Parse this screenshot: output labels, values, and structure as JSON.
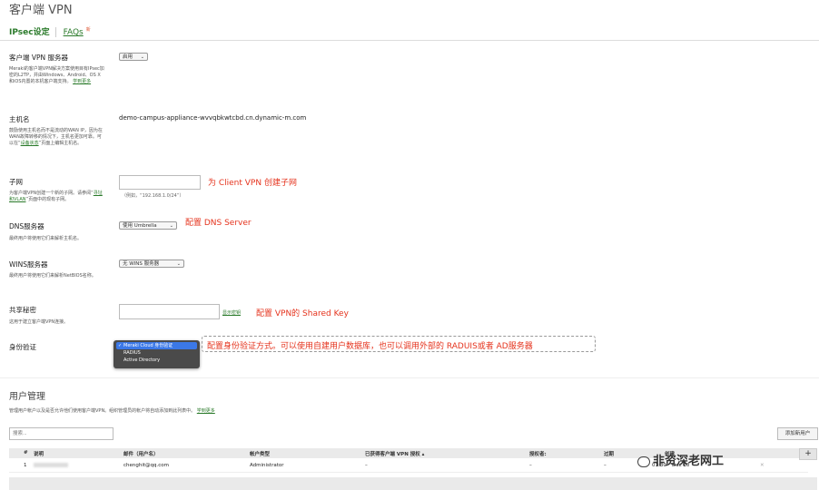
{
  "header": {
    "title": "客户端 VPN",
    "tab_ipsec": "IPsec设定",
    "tab_faqs": "FAQs",
    "tab_faqs_badge": "新"
  },
  "vpn_server": {
    "label": "客户端 VPN 服务器",
    "value": "启用",
    "desc": "Meraki的客户端VPN解决方案使用目有IPsec加密的L2TP，并由Windows、Android、OS X和iOS内置的本机客户端支持。",
    "learn_more": "学到更多"
  },
  "hostname": {
    "label": "主机名",
    "value": "demo-campus-appliance-wvvqbkwtcbd.cn.dynamic-m.com",
    "desc": "鼓励使用主机名而不是流动的WAN IP，因为在WAN故障转移的情况下，主机名更加可靠。可以在“",
    "link": "设备状态",
    "desc_end": "”页面上编辑主机名。"
  },
  "subnet": {
    "label": "子网",
    "value": "",
    "hint": "（例如，“192.168.1.0/24”）",
    "desc": "为客户端VPN创建一个新的子网。请参阅“",
    "link": "寻址和VLAN",
    "desc_end": "”页面中的现有子网。",
    "annotation": "为 Client VPN 创建子网"
  },
  "dns": {
    "label": "DNS服务器",
    "value": "使用 Umbrella",
    "desc": "最终用户将使用它们来解析主机名。",
    "annotation": "配置 DNS Server"
  },
  "wins": {
    "label": "WINS服务器",
    "value": "无 WINS 服务器",
    "desc": "最终用户将使用它们来解析NetBIOS名称。"
  },
  "secret": {
    "label": "共享秘密",
    "value": "",
    "show_link": "显示密钥",
    "desc": "这用于建立客户端VPN连接。",
    "annotation": "配置 VPN的 Shared Key"
  },
  "auth": {
    "label": "身份验证",
    "options": [
      "Meraki Cloud 身份验证",
      "RADIUS",
      "Active Directory"
    ],
    "selected_check": "✓",
    "annotation": "配置身份验证方式。可以使用自建用户数据库，也可以调用外部的 RADUIS或者 AD服务器"
  },
  "user_mgmt": {
    "title": "用户管理",
    "desc": "管理用户帐户以及是否允许他们使用客户端VPN。组织管理员的帐户将自动添加到此列表中。",
    "learn_more": "学到更多",
    "search_placeholder": "搜索...",
    "add_button": "添加新用户",
    "plus": "+",
    "columns": [
      "#",
      "说明",
      "邮件（用户名）",
      "帐户类型",
      "已获得客户端 VPN 授权 ▴",
      "授权者:",
      "过期",
      "创建"
    ],
    "rows": [
      {
        "num": "1",
        "email": "chenghit@qq.com",
        "type": "Administrator",
        "authorized": "–",
        "by": "–",
        "expires": "–",
        "created_time": "01:30",
        "created_date": "Dec 10",
        "delete": "✕"
      }
    ]
  },
  "watermark": "非资深老网工"
}
